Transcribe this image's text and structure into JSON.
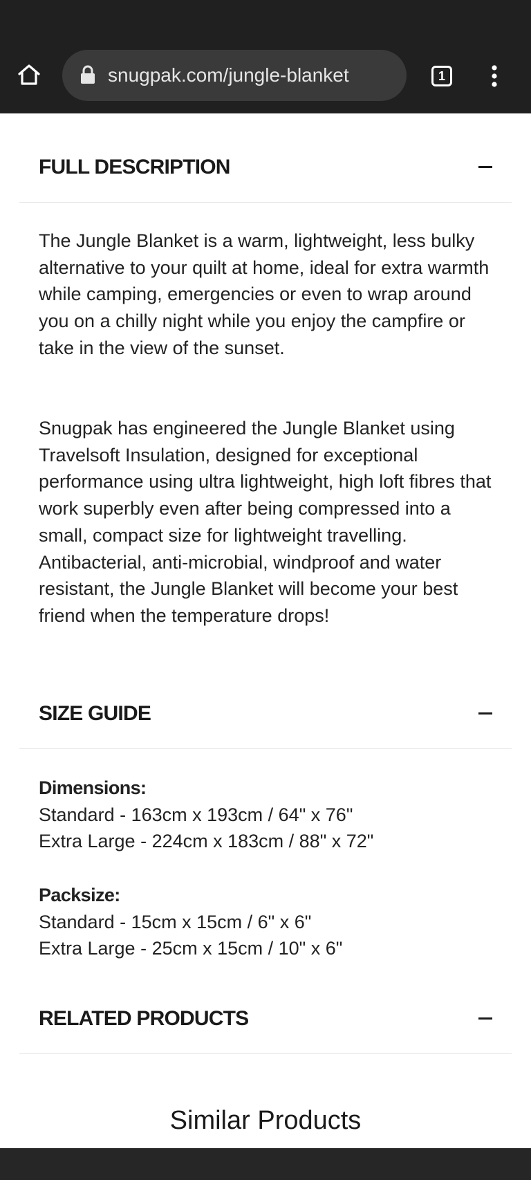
{
  "browser": {
    "url": "snugpak.com/jungle-blanket",
    "tab_count": "1",
    "icons": {
      "home": "home-icon",
      "lock": "lock-icon",
      "tabs": "tab-switcher-icon",
      "menu": "more-vert-icon"
    }
  },
  "sections": {
    "description": {
      "title": "FULL DESCRIPTION",
      "toggle_icon": "minus-icon",
      "paragraphs": [
        "The Jungle Blanket is a warm, lightweight, less bulky alternative to your quilt at home, ideal for extra warmth while camping, emergencies or even to wrap around you on a chilly night while you enjoy the campfire or take in the view of the sunset.",
        "Snugpak has engineered the Jungle Blanket using Travelsoft Insulation, designed for exceptional performance using ultra lightweight, high loft fibres that work superbly even after being compressed into a small, compact size for lightweight travelling. Antibacterial, anti-microbial, windproof and water resistant, the Jungle Blanket will become your best friend when the temperature drops!"
      ]
    },
    "size_guide": {
      "title": "SIZE GUIDE",
      "toggle_icon": "minus-icon",
      "dimensions": {
        "label": "Dimensions:",
        "lines": [
          "Standard - 163cm x 193cm / 64\" x 76\"",
          "Extra Large - 224cm x 183cm / 88\" x 72\""
        ]
      },
      "packsize": {
        "label": "Packsize:",
        "lines": [
          "Standard - 15cm x 15cm / 6\" x 6\"",
          "Extra Large - 25cm x 15cm / 10\" x 6\""
        ]
      }
    },
    "related": {
      "title": "RELATED PRODUCTS",
      "toggle_icon": "minus-icon",
      "similar_heading": "Similar Products"
    }
  },
  "colors": {
    "toolbar_bg": "#202020",
    "url_pill_bg": "#3a3a3a",
    "text": "#1a1a1a"
  }
}
